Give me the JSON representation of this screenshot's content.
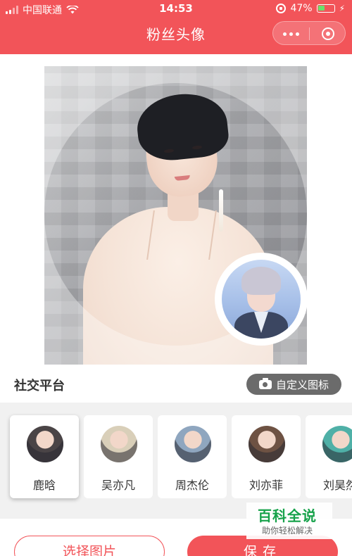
{
  "status_bar": {
    "carrier": "中国联通",
    "time": "14:53",
    "battery": "47%",
    "battery_level": 0.47
  },
  "header": {
    "title": "粉丝头像"
  },
  "section": {
    "title": "社交平台",
    "custom_icon_button": "自定义图标"
  },
  "stars": [
    {
      "name": "鹿晗",
      "selected": true,
      "avatar_bg": "#4a4446"
    },
    {
      "name": "吴亦凡",
      "selected": false,
      "avatar_bg": "#d9cfb9"
    },
    {
      "name": "周杰伦",
      "selected": false,
      "avatar_bg": "#8fa6bf"
    },
    {
      "name": "刘亦菲",
      "selected": false,
      "avatar_bg": "#6e5243"
    },
    {
      "name": "刘昊然",
      "selected": false,
      "avatar_bg": "#4fb0a7"
    }
  ],
  "actions": {
    "choose_image": "选择图片",
    "save": "保存"
  },
  "watermark": {
    "line1": "百科全说",
    "line2": "助你轻松解决"
  },
  "colors": {
    "brand_red": "#f25459",
    "button_gray": "#6b6b6b",
    "watermark_green": "#16a24a"
  }
}
